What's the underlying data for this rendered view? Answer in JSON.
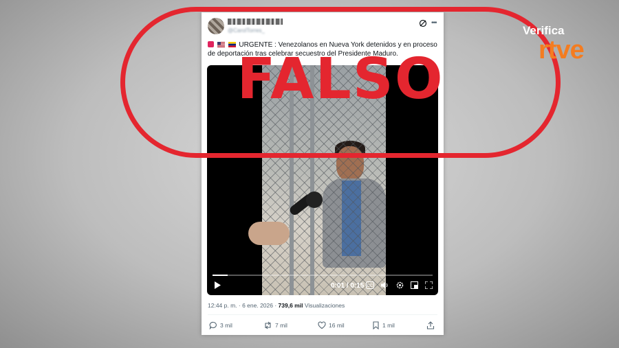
{
  "tweet": {
    "handle": "@CarolTorres_",
    "alarm_icon": "siren-emoji",
    "flags": [
      "us-flag",
      "venezuela-flag"
    ],
    "text": "URGENTE : Venezolanos en Nueva York detenidos y en proceso de deportación tras celebrar secuestro del Presidente Maduro.",
    "video": {
      "time": "0:01 / 0:15",
      "progress": 0.07,
      "cc_label": "CC"
    },
    "timestamp": "12:44 p. m. · 6 ene. 2026 · ",
    "views_count": "739,6 mil",
    "views_label": " Visualizaciones",
    "actions": {
      "replies": "3 mil",
      "reposts": "7 mil",
      "likes": "16 mil",
      "bookmarks": "1 mil"
    }
  },
  "stamp": {
    "text": "FALSO",
    "color": "#e4262f"
  },
  "brand": {
    "line1": "Verifica",
    "line2": "rtve",
    "accent": "#f47c20"
  }
}
